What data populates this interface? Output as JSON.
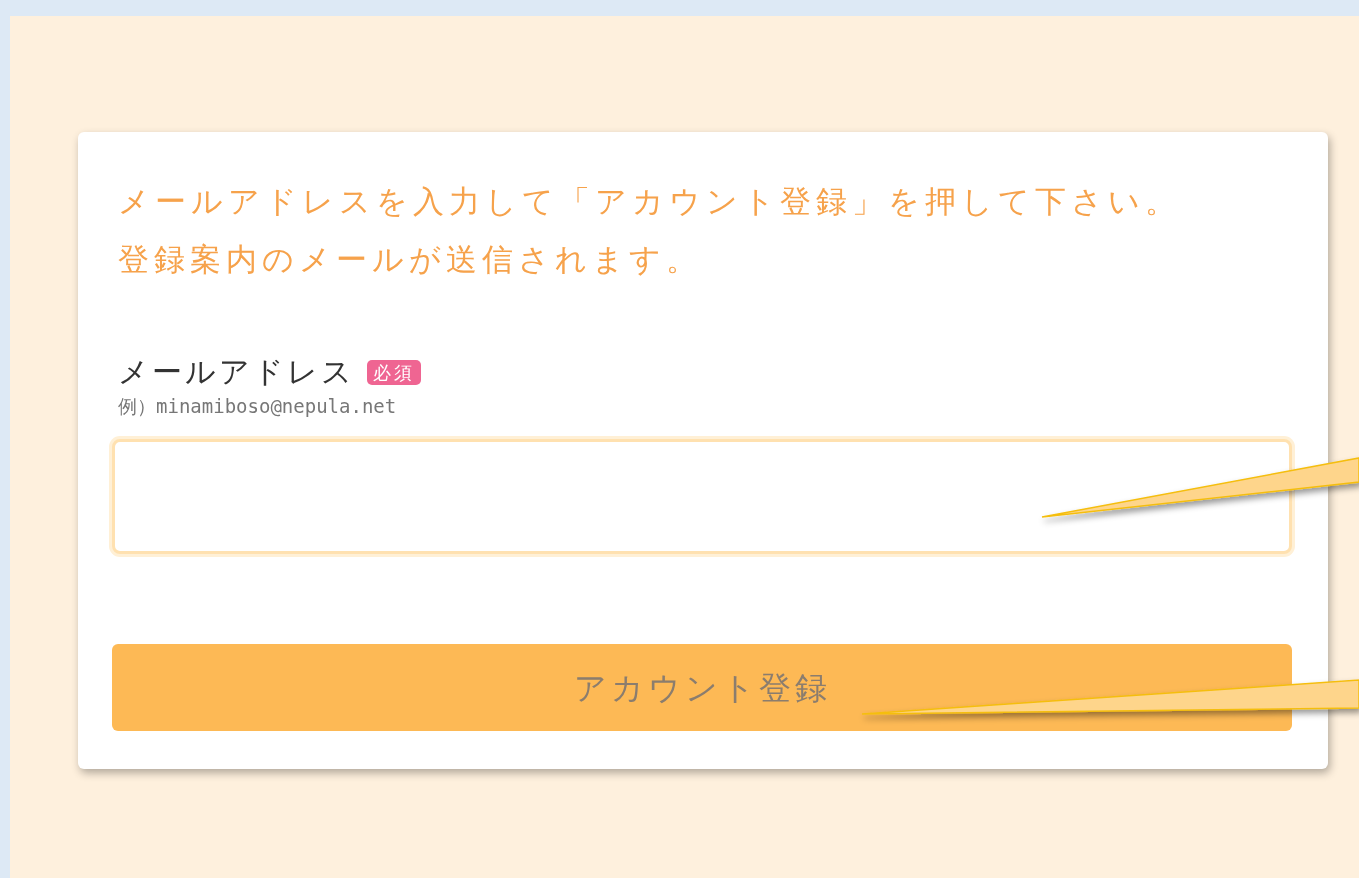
{
  "instructions": [
    "メールアドレスを入力して「アカウント登録」を押して下さい。",
    "登録案内のメールが送信されます。"
  ],
  "email_field": {
    "label": "メールアドレス",
    "required_badge": "必須",
    "example": "例）minamiboso@nepula.net"
  },
  "submit_button": {
    "label": "アカウント登録"
  },
  "annotations": [
    {
      "kind": "callout"
    },
    {
      "kind": "callout"
    }
  ]
}
